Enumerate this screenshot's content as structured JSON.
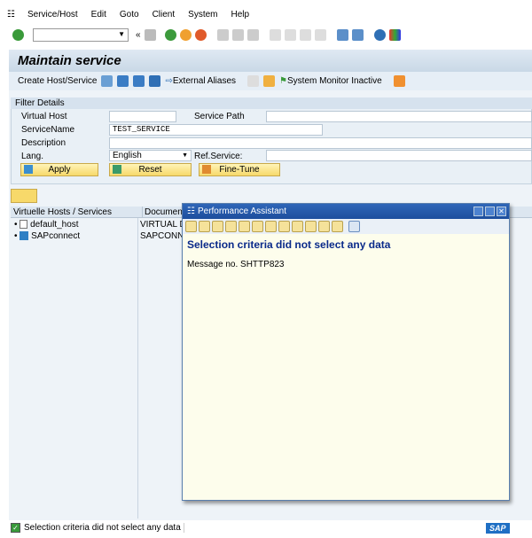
{
  "menu": {
    "items": [
      "Service/Host",
      "Edit",
      "Goto",
      "Client",
      "System",
      "Help"
    ]
  },
  "toolbar": {
    "command_value": "",
    "back_label": "«"
  },
  "page_title": "Maintain service",
  "app_toolbar": {
    "create": "Create Host/Service",
    "external_aliases": "External Aliases",
    "system_monitor": "System Monitor Inactive"
  },
  "filter": {
    "title": "Filter Details",
    "virtual_host_label": "Virtual Host",
    "virtual_host_value": "",
    "service_path_label": "Service Path",
    "service_path_value": "",
    "service_name_label": "ServiceName",
    "service_name_value": "TEST_SERVICE",
    "description_label": "Description",
    "description_value": "",
    "lang_label": "Lang.",
    "lang_value": "English",
    "ref_service_label": "Ref.Service:",
    "ref_service_value": "",
    "apply": "Apply",
    "reset": "Reset",
    "fine_tune": "Fine-Tune"
  },
  "tree": {
    "col1": "Virtuelle Hosts / Services",
    "col2": "Documentation",
    "rows": [
      {
        "name": "default_host",
        "doc": "VIRTUAL DEFAULT HOST"
      },
      {
        "name": "SAPconnect",
        "doc": "SAPCONNECT"
      }
    ]
  },
  "dialog": {
    "title": "Performance Assistant",
    "heading": "Selection criteria did not select any data",
    "message": "Message no. SHTTP823"
  },
  "status": {
    "message": "Selection criteria did not select any data",
    "logo": "SAP"
  }
}
